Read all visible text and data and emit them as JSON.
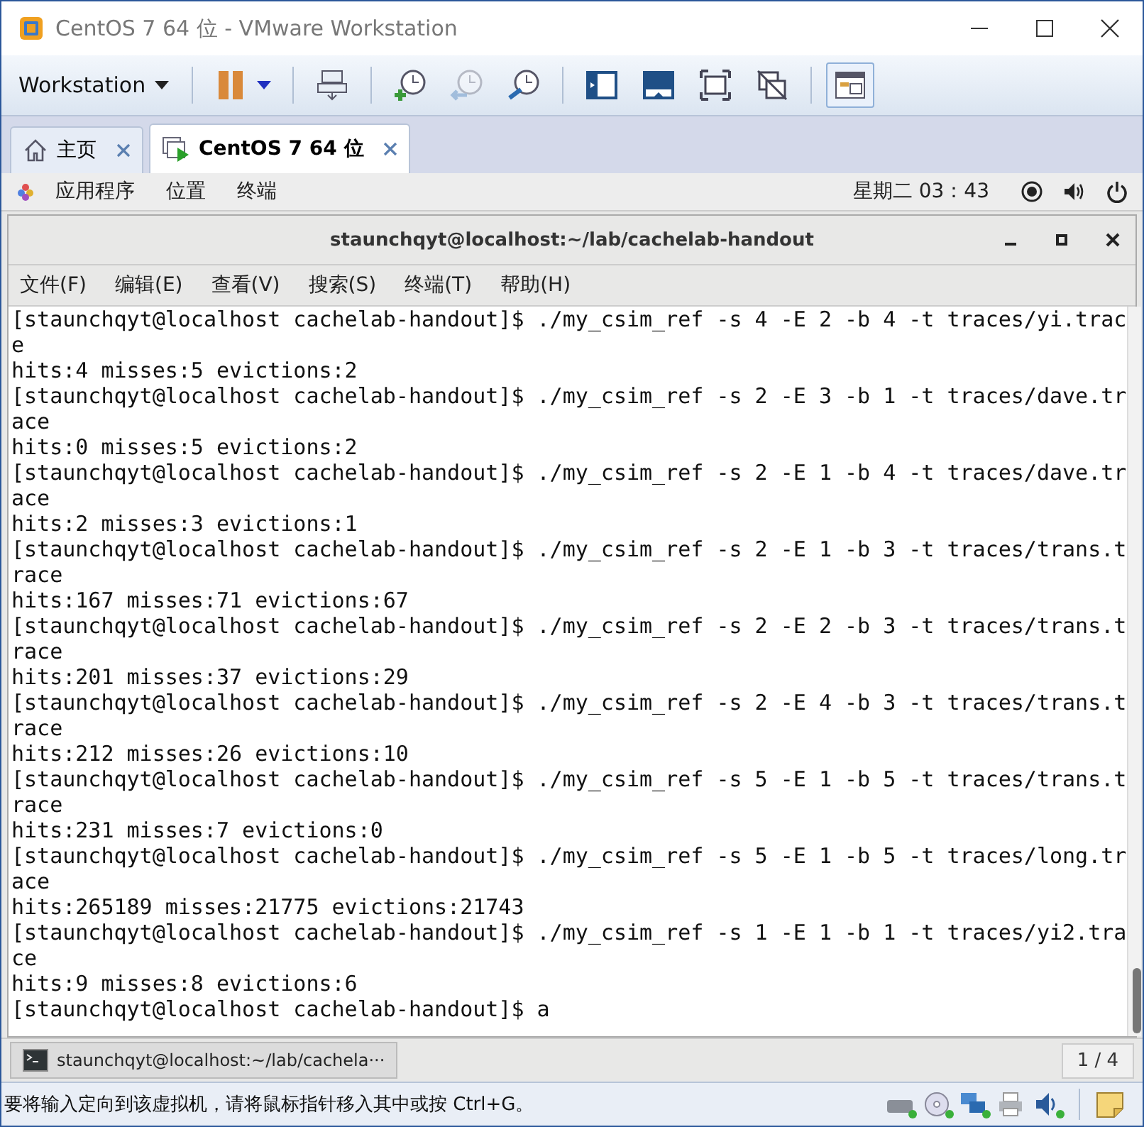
{
  "window": {
    "title": "CentOS 7 64 位 - VMware Workstation"
  },
  "toolbar": {
    "menu_label": "Workstation",
    "buttons": [
      {
        "kind": "pause",
        "disabled": false,
        "toggled": false
      },
      {
        "kind": "send-keys",
        "disabled": false,
        "toggled": false
      },
      {
        "kind": "snapshot",
        "disabled": false,
        "toggled": false
      },
      {
        "kind": "revert",
        "disabled": true,
        "toggled": false
      },
      {
        "kind": "manage-snapshots",
        "disabled": false,
        "toggled": false
      },
      {
        "kind": "library",
        "disabled": false,
        "toggled": false
      },
      {
        "kind": "console",
        "disabled": false,
        "toggled": false
      },
      {
        "kind": "fullscreen",
        "disabled": false,
        "toggled": false
      },
      {
        "kind": "unity",
        "disabled": false,
        "toggled": false
      },
      {
        "kind": "thumbnail",
        "disabled": false,
        "toggled": true
      }
    ]
  },
  "tabs": [
    {
      "kind": "home",
      "label": "主页",
      "selected": false
    },
    {
      "kind": "vm",
      "label": "CentOS 7 64 位",
      "selected": true
    }
  ],
  "guest": {
    "top_bar": {
      "menus": [
        "应用程序",
        "位置",
        "终端"
      ],
      "clock": "星期二 03：43"
    },
    "terminal": {
      "title": "staunchqyt@localhost:~/lab/cachelab-handout",
      "menu": [
        "文件(F)",
        "编辑(E)",
        "查看(V)",
        "搜索(S)",
        "终端(T)",
        "帮助(H)"
      ],
      "lines": [
        "[staunchqyt@localhost cachelab-handout]$ ./my_csim_ref -s 4 -E 2 -b 4 -t traces/yi.trac",
        "e",
        "hits:4 misses:5 evictions:2",
        "[staunchqyt@localhost cachelab-handout]$ ./my_csim_ref -s 2 -E 3 -b 1 -t traces/dave.tr",
        "ace",
        "hits:0 misses:5 evictions:2",
        "[staunchqyt@localhost cachelab-handout]$ ./my_csim_ref -s 2 -E 1 -b 4 -t traces/dave.tr",
        "ace",
        "hits:2 misses:3 evictions:1",
        "[staunchqyt@localhost cachelab-handout]$ ./my_csim_ref -s 2 -E 1 -b 3 -t traces/trans.t",
        "race",
        "hits:167 misses:71 evictions:67",
        "[staunchqyt@localhost cachelab-handout]$ ./my_csim_ref -s 2 -E 2 -b 3 -t traces/trans.t",
        "race",
        "hits:201 misses:37 evictions:29",
        "[staunchqyt@localhost cachelab-handout]$ ./my_csim_ref -s 2 -E 4 -b 3 -t traces/trans.t",
        "race",
        "hits:212 misses:26 evictions:10",
        "[staunchqyt@localhost cachelab-handout]$ ./my_csim_ref -s 5 -E 1 -b 5 -t traces/trans.t",
        "race",
        "hits:231 misses:7 evictions:0",
        "[staunchqyt@localhost cachelab-handout]$ ./my_csim_ref -s 5 -E 1 -b 5 -t traces/long.tr",
        "ace",
        "hits:265189 misses:21775 evictions:21743",
        "[staunchqyt@localhost cachelab-handout]$ ./my_csim_ref -s 1 -E 1 -b 1 -t traces/yi2.tra",
        "ce",
        "hits:9 misses:8 evictions:6",
        "[staunchqyt@localhost cachelab-handout]$ a"
      ]
    },
    "taskbar": {
      "window_label": "staunchqyt@localhost:~/lab/cachela···",
      "workspace": "1 / 4"
    }
  },
  "status_bar": {
    "message": "要将输入定向到该虚拟机，请将鼠标指针移入其中或按 Ctrl+G。"
  }
}
